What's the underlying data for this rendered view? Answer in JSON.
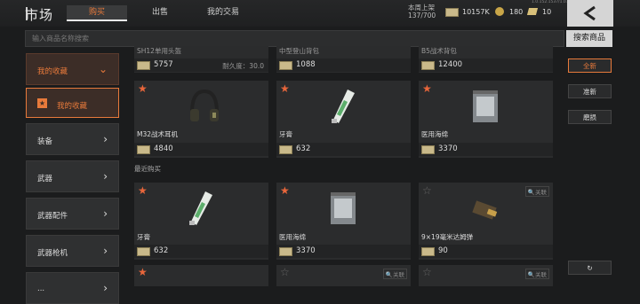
{
  "header": {
    "title": "市场",
    "tabs": [
      {
        "label": "购买"
      },
      {
        "label": "出售"
      },
      {
        "label": "我的交易"
      }
    ],
    "week_label": "本周上架",
    "week_count": "137/700",
    "currencies": [
      {
        "icon": "cash-icon",
        "value": "10157K"
      },
      {
        "icon": "coin-icon",
        "value": "180"
      },
      {
        "icon": "ticket-icon",
        "value": "10"
      }
    ],
    "build": "1.0.152.1537/1.0.152253.1.0.223.80.2.0"
  },
  "search": {
    "placeholder": "输入商品名称搜索",
    "button": "搜索商品"
  },
  "sidebar": {
    "items": [
      {
        "label": "我的收藏"
      },
      {
        "label": "我的收藏"
      },
      {
        "label": "装备"
      },
      {
        "label": "武器"
      },
      {
        "label": "武器配件"
      },
      {
        "label": "武器枪机"
      },
      {
        "label": "..."
      }
    ]
  },
  "top_row": [
    {
      "name": "SH12单用头盔",
      "price": "5757",
      "durability": "耐久度：30.0"
    },
    {
      "name": "中型登山背包",
      "price": "1088"
    },
    {
      "name": "B5战术背包",
      "price": "12400"
    }
  ],
  "fav_row": [
    {
      "name": "M32战术耳机",
      "price": "4840"
    },
    {
      "name": "牙膏",
      "price": "632"
    },
    {
      "name": "医用海绵",
      "price": "3370"
    }
  ],
  "section_title": "最近购买",
  "recent_row": [
    {
      "name": "牙膏",
      "price": "632",
      "follow": ""
    },
    {
      "name": "医用海绵",
      "price": "3370",
      "follow": ""
    },
    {
      "name": "9×19毫米达姆弹",
      "price": "90",
      "follow": "关联"
    }
  ],
  "bottom_row_follow": [
    "关联",
    "关联"
  ],
  "right_buttons": [
    {
      "label": "全新"
    },
    {
      "label": "准新"
    },
    {
      "label": "磨损"
    }
  ],
  "colors": {
    "accent": "#e87a3b",
    "background": "#1b1c1d"
  }
}
